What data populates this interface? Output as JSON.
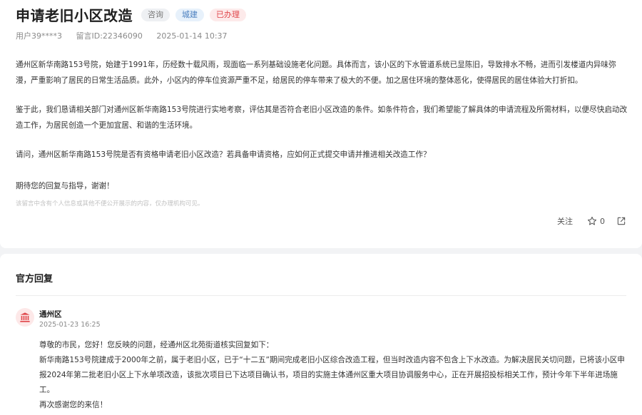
{
  "question": {
    "title": "申请老旧小区改造",
    "tags": [
      "咨询",
      "城建",
      "已办理"
    ],
    "user": "用户39****3",
    "message_id": "留言ID:22346090",
    "datetime": "2025-01-14 10:37",
    "paragraphs": [
      "通州区新华南路153号院，始建于1991年，历经数十载风雨，现面临一系列基础设施老化问题。具体而言，该小区的下水管道系统已显陈旧，导致排水不畅，进而引发楼道内异味弥漫，严重影响了居民的日常生活品质。此外，小区内的停车位资源严重不足，给居民的停车带来了极大的不便。加之居住环境的整体恶化，使得居民的居住体验大打折扣。",
      "鉴于此，我们恳请相关部门对通州区新华南路153号院进行实地考察，评估其是否符合老旧小区改造的条件。如条件符合，我们希望能了解具体的申请流程及所需材料，以便尽快启动改造工作，为居民创造一个更加宜居、和谐的生活环境。",
      "请问，通州区新华南路153号院是否有资格申请老旧小区改造？若具备申请资格，应如何正式提交申请并推进相关改造工作？",
      "期待您的回复与指导，谢谢！"
    ],
    "privacy_note": "该留言中含有个人信息或其他不便公开展示的内容，仅办理机构可见。",
    "follow_label": "关注",
    "star_count": "0"
  },
  "reply": {
    "section_title": "官方回复",
    "org": "通州区",
    "datetime": "2025-01-23 16:25",
    "lines": [
      "尊敬的市民，您好！您反映的问题，经通州区北苑街道核实回复如下：",
      "新华南路153号院建成于2000年之前，属于老旧小区，已于“十二五”期间完成老旧小区综合改造工程，但当时改造内容不包含上下水改造。为解决居民关切问题，已将该小区申报2024年第二批老旧小区上下水单项改造，该批次项目已下达项目确认书，项目的实施主体通州区重大项目协调服务中心，正在开展招投标相关工作，预计今年下半年进场施工。",
      "再次感谢您的来信！"
    ]
  },
  "colors": {
    "tag_red": "#e0484c",
    "tag_blue": "#4a7fbf",
    "avatar_icon": "#e0484c"
  },
  "icons": [
    "star-icon",
    "share-icon",
    "government-building-icon"
  ]
}
